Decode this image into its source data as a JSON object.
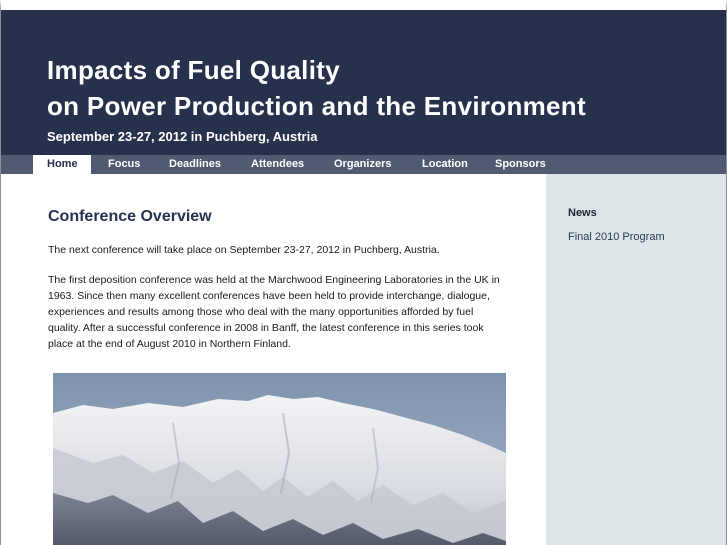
{
  "header": {
    "title_line1": "Impacts of Fuel Quality",
    "title_line2": "on Power Production and the Environment",
    "subtitle": "September 23-27, 2012 in Puchberg, Austria"
  },
  "nav": {
    "items": [
      {
        "label": "Home",
        "active": true
      },
      {
        "label": "Focus"
      },
      {
        "label": "Deadlines"
      },
      {
        "label": "Attendees"
      },
      {
        "label": "Organizers"
      },
      {
        "label": "Location"
      },
      {
        "label": "Sponsors"
      }
    ]
  },
  "main": {
    "heading": "Conference Overview",
    "para1": "The next conference will take place on September 23-27, 2012 in Puchberg, Austria.",
    "para2": "The first deposition conference was held at the Marchwood Engineering Laboratories in the UK in 1963. Since then many excellent conferences have been held to provide interchange, dialogue, experiences and results among those who deal with the many opportunities afforded by fuel quality. After a successful conference in 2008 in Banff, the latest conference in this series took place at the end of August 2010 in Northern Finland."
  },
  "sidebar": {
    "heading": "News",
    "link": "Final 2010 Program"
  },
  "colors": {
    "header_bg": "#27314b",
    "nav_bg": "#505b71",
    "sidebar_bg": "#dde5e8",
    "heading_color": "#26324f"
  }
}
